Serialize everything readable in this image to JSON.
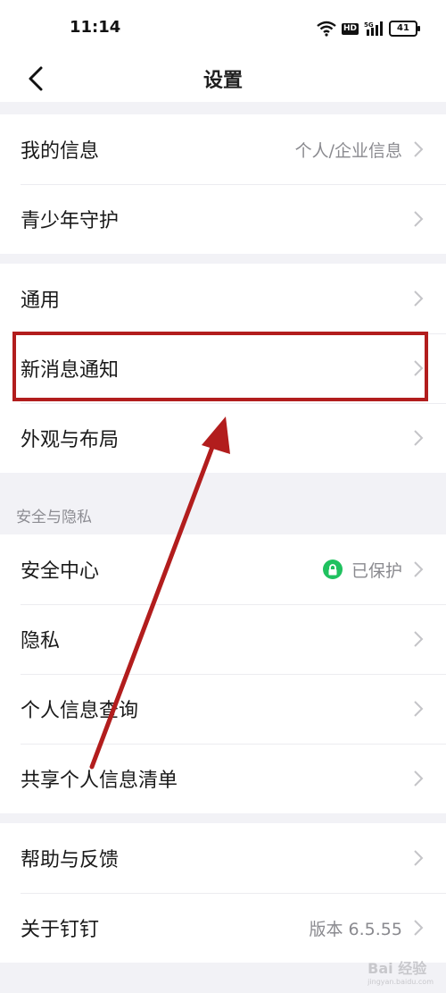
{
  "status_bar": {
    "time": "11:14",
    "battery": "41"
  },
  "header": {
    "title": "设置"
  },
  "groups": [
    {
      "items": [
        {
          "label": "我的信息",
          "value": "个人/企业信息"
        },
        {
          "label": "青少年守护"
        }
      ]
    },
    {
      "items": [
        {
          "label": "通用"
        },
        {
          "label": "新消息通知"
        },
        {
          "label": "外观与布局"
        }
      ]
    },
    {
      "section_title": "安全与隐私",
      "items": [
        {
          "label": "安全中心",
          "value": "已保护"
        },
        {
          "label": "隐私"
        },
        {
          "label": "个人信息查询"
        },
        {
          "label": "共享个人信息清单"
        }
      ]
    },
    {
      "items": [
        {
          "label": "帮助与反馈"
        },
        {
          "label": "关于钉钉",
          "value": "版本 6.5.55"
        }
      ]
    }
  ],
  "watermark": {
    "text": "Bai 经验",
    "sub": "jingyan.baidu.com"
  },
  "colors": {
    "annotation": "#b21d1d",
    "protected_green": "#1fc15f"
  }
}
